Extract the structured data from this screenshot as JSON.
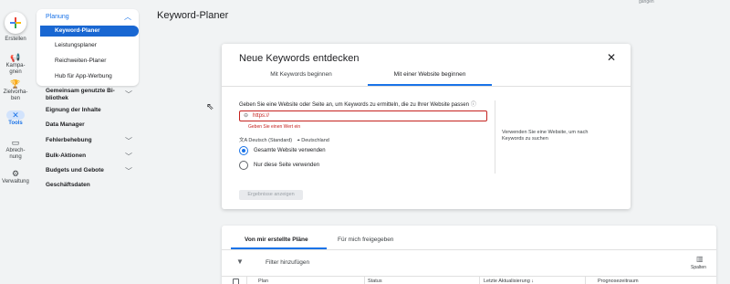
{
  "rail": {
    "create_label": "Erstellen",
    "items": [
      {
        "icon": "megaphone-icon",
        "label": "Kampa-\ngnen"
      },
      {
        "icon": "trophy-icon",
        "label": "Zielvorha-\nben"
      },
      {
        "icon": "tools-icon",
        "label": "Tools"
      },
      {
        "icon": "billing-icon",
        "label": "Abrech-\nnung"
      },
      {
        "icon": "gear-icon",
        "label": "Verwaltung"
      }
    ]
  },
  "nav": {
    "planning": "Planung",
    "sub_items": [
      "Keyword-Planer",
      "Leistungsplaner",
      "Reichweiten-Planer",
      "Hub für App-Werbung"
    ],
    "items": [
      "Gemeinsam genutzte Bi-\nbliothek",
      "Eignung der Inhalte",
      "Data Manager",
      "Fehlerbehebung",
      "Bulk-Aktionen",
      "Budgets und Gebote",
      "Geschäftsdaten"
    ]
  },
  "page_title": "Keyword-Planer",
  "top_right_text": "gangen",
  "dialog": {
    "title": "Neue Keywords entdecken",
    "tabs": [
      "Mit Keywords beginnen",
      "Mit einer Website beginnen"
    ],
    "active_tab": 1,
    "field_label": "Geben Sie eine Website oder Seite an, um Keywords zu ermitteln, die zu Ihrer Website passen",
    "url_value": "https://",
    "error": "Geben Sie einen Wert ein",
    "language": "Deutsch (Standard)",
    "location": "Deutschland",
    "radio_options": [
      "Gesamte Website verwenden",
      "Nur diese Seite verwenden"
    ],
    "radio_selected": 0,
    "side_note": "Verwenden Sie eine Website, um nach Keywords zu suchen",
    "submit": "Ergebnisse anzeigen"
  },
  "plans": {
    "tabs": [
      "Von mir erstellte Pläne",
      "Für mich freigegeben"
    ],
    "filter": "Filter hinzufügen",
    "columns_label": "Spalten",
    "headers": [
      "Plan",
      "Status",
      "Letzte Aktualisierung",
      "Prognosezeitraum"
    ]
  },
  "colors": {
    "accent": "#1a73e8",
    "error": "#c5221f"
  }
}
